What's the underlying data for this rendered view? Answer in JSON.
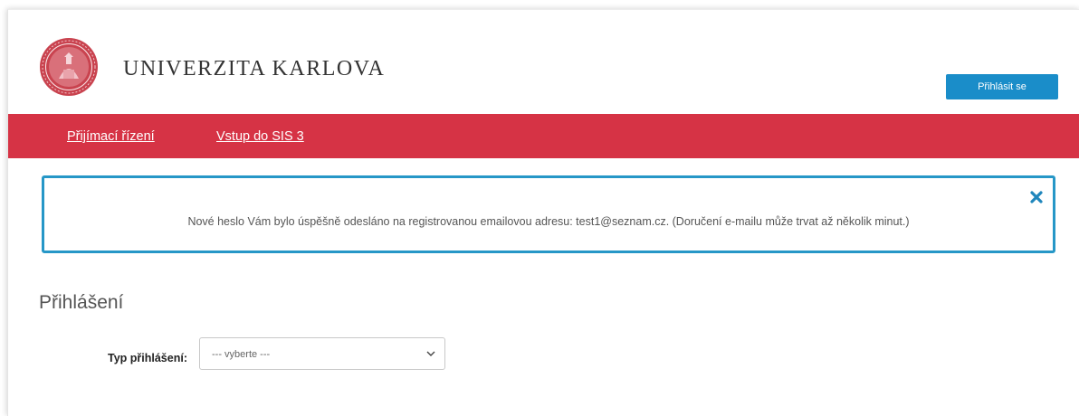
{
  "header": {
    "brand_name": "UNIVERZITA KARLOVA",
    "login_button": "Přihlásit se"
  },
  "nav": {
    "items": [
      {
        "label": "Přijímací řízení"
      },
      {
        "label": "Vstup do SIS 3"
      }
    ]
  },
  "alert": {
    "message": "Nové heslo Vám bylo úspěšně odesláno na registrovanou emailovou adresu: test1@seznam.cz. (Doručení e-mailu může trvat až několik minut.)",
    "close_icon": "close-icon"
  },
  "login_section": {
    "title": "Přihlášení",
    "type_label": "Typ přihlášení:",
    "type_select_value": "--- vyberte ---"
  },
  "colors": {
    "nav_background": "#d63345",
    "button_background": "#1a8dc9",
    "alert_border": "#2697c7",
    "seal": "#c9434f"
  }
}
